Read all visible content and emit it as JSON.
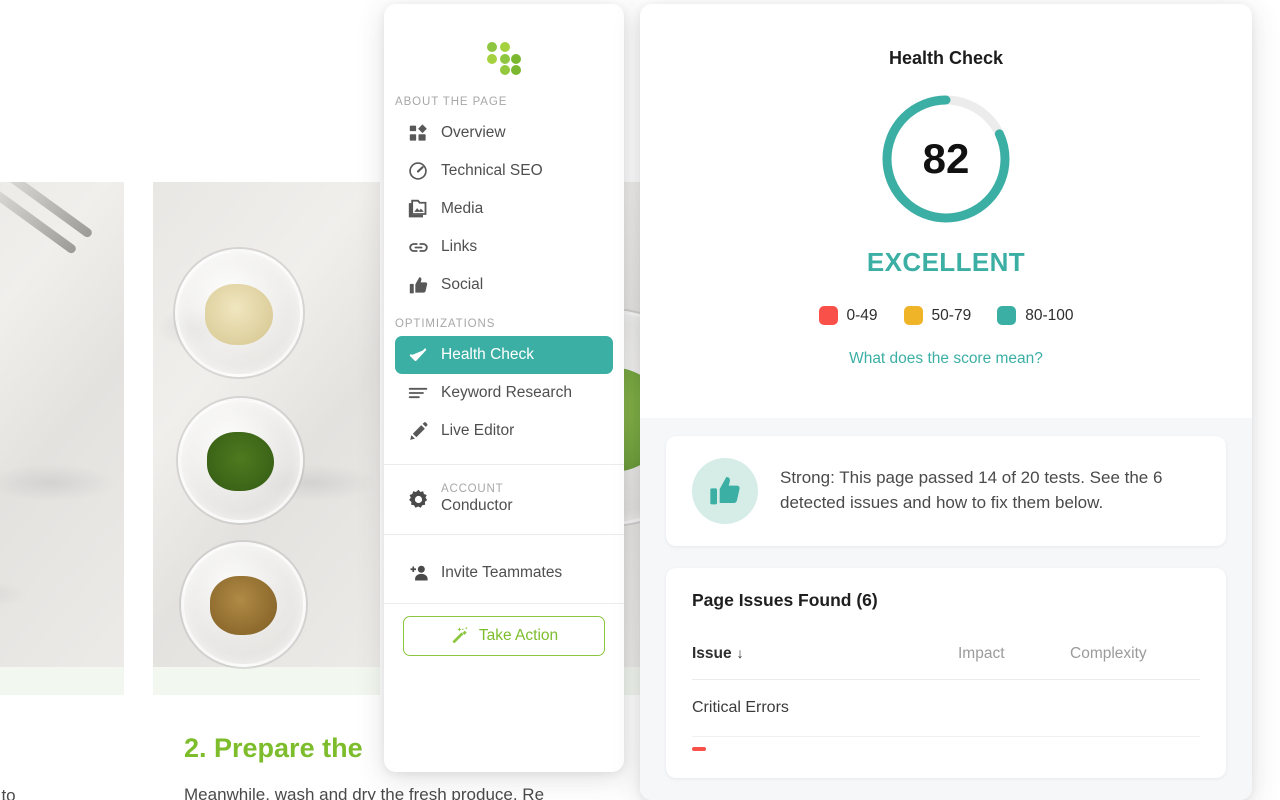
{
  "background_page": {
    "step_title": "2. Prepare the",
    "step_body": "Meanwhile, wash and dry the fresh produce. Re",
    "left_text": "t to",
    "photo_alt_1": "stainless-steel-tongs-on-marble",
    "photo_alt_2": "glass-prep-bowls-garlic-herbs-walnuts",
    "photo_alt_3": "glass-bowl-of-chopped-kale"
  },
  "sidebar": {
    "logo_name": "conductor-dot-logo",
    "logo_colors": [
      "#8ec63f",
      "#a6d13f",
      "#7cb82f",
      "#95c93d"
    ],
    "sections": [
      {
        "label": "ABOUT THE PAGE",
        "items": [
          {
            "label": "Overview",
            "icon": "dashboard-icon",
            "active": false
          },
          {
            "label": "Technical SEO",
            "icon": "gauge-icon",
            "active": false
          },
          {
            "label": "Media",
            "icon": "image-stack-icon",
            "active": false
          },
          {
            "label": "Links",
            "icon": "link-icon",
            "active": false
          },
          {
            "label": "Social",
            "icon": "thumbs-up-icon",
            "active": false
          }
        ]
      },
      {
        "label": "OPTIMIZATIONS",
        "items": [
          {
            "label": "Health Check",
            "icon": "check-icon",
            "active": true
          },
          {
            "label": "Keyword Research",
            "icon": "list-lines-icon",
            "active": false
          },
          {
            "label": "Live Editor",
            "icon": "pencil-icon",
            "active": false
          }
        ]
      }
    ],
    "account": {
      "kicker": "ACCOUNT",
      "name": "Conductor",
      "icon": "gear-icon"
    },
    "invite": {
      "label": "Invite Teammates",
      "icon": "add-person-icon"
    },
    "cta": {
      "label": "Take Action",
      "icon": "magic-wand-icon",
      "border_color": "#8cc63f",
      "text_color": "#7dbd2c"
    },
    "active_color": "#3cafa5"
  },
  "health_check": {
    "title": "Health Check",
    "score": "82",
    "score_value": 82,
    "verdict": "EXCELLENT",
    "verdict_color": "#3cafa5",
    "track_color": "#ececec",
    "legend": [
      {
        "range": "0-49",
        "color": "#f9514a"
      },
      {
        "range": "50-79",
        "color": "#f0b429"
      },
      {
        "range": "80-100",
        "color": "#3cafa5"
      }
    ],
    "score_link": "What does the score mean?"
  },
  "summary_card": {
    "icon": "thumbs-up-icon",
    "text": "Strong: This page passed 14 of 20 tests. See the 6 detected issues and how to fix them below."
  },
  "issues": {
    "title": "Page Issues Found (6)",
    "columns": {
      "issue": "Issue",
      "sort_indicator": "↓",
      "impact": "Impact",
      "complexity": "Complexity"
    },
    "rows": [
      {
        "issue": "Critical Errors",
        "impact": "",
        "complexity": ""
      }
    ]
  }
}
